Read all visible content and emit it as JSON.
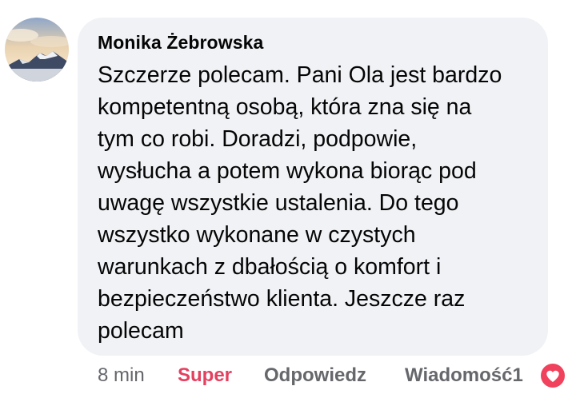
{
  "comment": {
    "author": "Monika Żebrowska",
    "text": "Szczerze polecam. Pani Ola jest bardzo\nkompetentną osobą, która zna się na\ntym co robi. Doradzi, podpowie,\nwysłucha a potem wykona biorąc pod\nuwagę wszystkie ustalenia. Do tego\nwszystko wykonane w czystych\nwarunkach z dbałością o komfort i\nbezpieczeństwo klienta. Jeszcze raz\npolecam"
  },
  "actions": {
    "time": "8 min",
    "reaction_label": "Super",
    "reply_label": "Odpowiedz",
    "message_label": "Wiadomość",
    "reaction_count": "1"
  },
  "icons": {
    "avatar": "mountain-landscape-avatar",
    "reaction": "heart-reaction-icon"
  },
  "colors": {
    "bubble": "#f0f2f5",
    "text": "#050505",
    "muted": "#65676b",
    "reaction": "#e4405f"
  }
}
